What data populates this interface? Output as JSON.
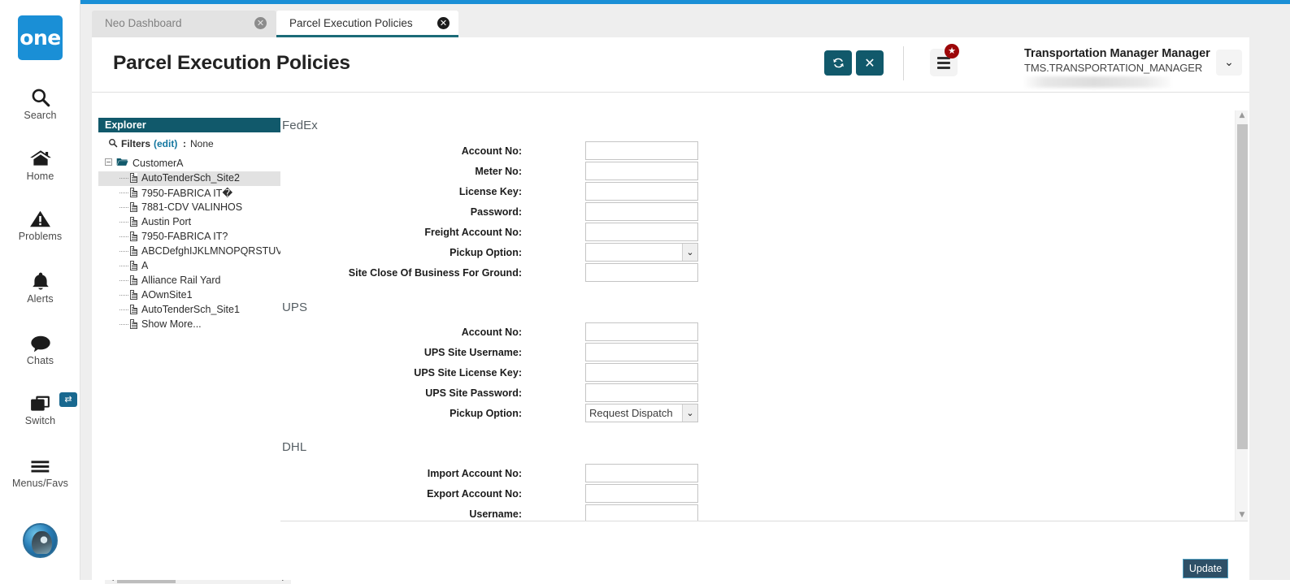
{
  "brand": {
    "logo_text": "one",
    "accent_teal": "#11596b",
    "accent_blue": "#1a8fd6",
    "badge_red": "#9c0608"
  },
  "left_rail": {
    "items": [
      {
        "name": "search",
        "label": "Search",
        "icon": "search-icon"
      },
      {
        "name": "home",
        "label": "Home",
        "icon": "home-icon"
      },
      {
        "name": "problems",
        "label": "Problems",
        "icon": "warning-triangle-icon"
      },
      {
        "name": "alerts",
        "label": "Alerts",
        "icon": "bell-icon"
      },
      {
        "name": "chats",
        "label": "Chats",
        "icon": "speech-bubble-icon"
      },
      {
        "name": "switch",
        "label": "Switch",
        "icon": "windows-stack-icon",
        "badge_icon": "swap-arrows-icon"
      },
      {
        "name": "menus_favs",
        "label": "Menus/Favs",
        "icon": "hamburger-icon"
      }
    ],
    "avatar_icon": "user-avatar-icon"
  },
  "tabs": [
    {
      "label": "Neo Dashboard",
      "active": false,
      "close_icon": "close-circle-icon"
    },
    {
      "label": "Parcel Execution Policies",
      "active": true,
      "close_icon": "close-circle-icon"
    }
  ],
  "header": {
    "title": "Parcel Execution Policies",
    "refresh_icon": "refresh-icon",
    "close_icon": "x-icon",
    "menu_icon": "list-menu-icon",
    "menu_badge_icon": "star-icon",
    "user_name": "Transportation Manager Manager",
    "user_role": "TMS.TRANSPORTATION_MANAGER",
    "user_caret_icon": "chevron-down-icon"
  },
  "explorer": {
    "title": "Explorer",
    "search_icon": "search-icon",
    "filters_label": "Filters",
    "filters_edit_label": "(edit)",
    "filters_colon": ":",
    "filters_value": "None",
    "root": {
      "label": "CustomerA",
      "expander": "−",
      "folder_icon": "open-folder-icon",
      "expanded": true
    },
    "items": [
      {
        "label": "AutoTenderSch_Site2",
        "selected": true
      },
      {
        "label": "7950-FABRICA IT�",
        "selected": false
      },
      {
        "label": "7881-CDV VALINHOS",
        "selected": false
      },
      {
        "label": "Austin Port",
        "selected": false
      },
      {
        "label": "7950-FABRICA IT?",
        "selected": false
      },
      {
        "label": "ABCDefghIJKLMNOPQRSTUVWXY",
        "selected": false
      },
      {
        "label": "A",
        "selected": false
      },
      {
        "label": "Alliance Rail Yard",
        "selected": false
      },
      {
        "label": "AOwnSite1",
        "selected": false
      },
      {
        "label": "AutoTenderSch_Site1",
        "selected": false
      },
      {
        "label": "Show More...",
        "selected": false
      }
    ],
    "hscroll": {
      "left_arrow_icon": "triangle-left-icon",
      "right_arrow_icon": "triangle-right-icon"
    }
  },
  "form": {
    "sections": [
      {
        "title": "FedEx",
        "fields": [
          {
            "label": "Account No:",
            "type": "text",
            "value": ""
          },
          {
            "label": "Meter No:",
            "type": "text",
            "value": ""
          },
          {
            "label": "License Key:",
            "type": "text",
            "value": ""
          },
          {
            "label": "Password:",
            "type": "text",
            "value": ""
          },
          {
            "label": "Freight Account No:",
            "type": "text",
            "value": ""
          },
          {
            "label": "Pickup Option:",
            "type": "select",
            "value": ""
          },
          {
            "label": "Site Close Of Business For Ground:",
            "type": "text",
            "value": ""
          }
        ]
      },
      {
        "title": "UPS",
        "fields": [
          {
            "label": "Account No:",
            "type": "text",
            "value": ""
          },
          {
            "label": "UPS Site Username:",
            "type": "text",
            "value": ""
          },
          {
            "label": "UPS Site License Key:",
            "type": "text",
            "value": ""
          },
          {
            "label": "UPS Site Password:",
            "type": "text",
            "value": ""
          },
          {
            "label": "Pickup Option:",
            "type": "select",
            "value": "Request Dispatch"
          }
        ]
      },
      {
        "title": "DHL",
        "fields": [
          {
            "label": "Import Account No:",
            "type": "text",
            "value": ""
          },
          {
            "label": "Export Account No:",
            "type": "text",
            "value": ""
          },
          {
            "label": "Username:",
            "type": "text",
            "value": ""
          }
        ]
      }
    ],
    "select_caret_icon": "chevron-down-icon"
  },
  "scrollbar": {
    "up_arrow_icon": "triangle-up-icon",
    "down_arrow_icon": "triangle-down-icon"
  },
  "footer": {
    "update_label": "Update"
  }
}
